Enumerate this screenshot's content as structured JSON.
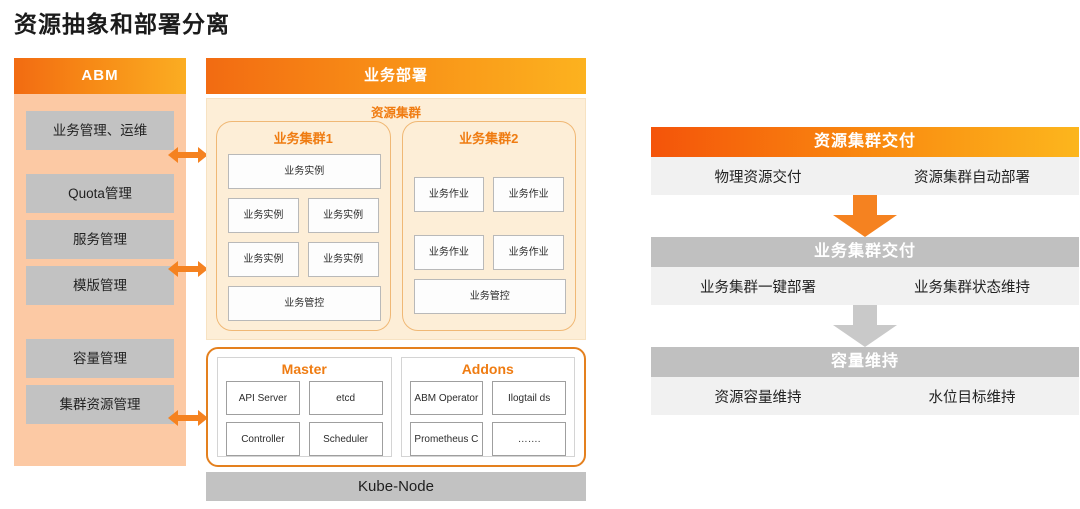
{
  "title": "资源抽象和部署分离",
  "colors": {
    "orange": "#f07c12",
    "orange_dark": "#f4540a",
    "orange_light": "#fcb21f",
    "grey_box": "#c2c2c2",
    "peach": "#fcc9a4",
    "cream": "#fdeed7"
  },
  "abm": {
    "header": "ABM",
    "items": [
      {
        "label": "业务管理、运维"
      },
      {
        "label": "Quota管理"
      },
      {
        "label": "服务管理"
      },
      {
        "label": "模版管理"
      },
      {
        "label": "容量管理"
      },
      {
        "label": "集群资源管理"
      }
    ]
  },
  "deploy": {
    "header": "业务部署",
    "resource_cluster_title": "资源集群",
    "clusters": [
      {
        "title": "业务集群1",
        "top_cell": "业务实例",
        "grid": [
          [
            "业务实例",
            "业务实例"
          ],
          [
            "业务实例",
            "业务实例"
          ]
        ],
        "bottom_cell": "业务管控"
      },
      {
        "title": "业务集群2",
        "top_cell": "",
        "grid": [
          [
            "业务作业",
            "业务作业"
          ],
          [
            "业务作业",
            "业务作业"
          ]
        ],
        "bottom_cell": "业务管控"
      }
    ],
    "master": {
      "title": "Master",
      "cells": [
        [
          "API Server",
          "etcd"
        ],
        [
          "Controller",
          "Scheduler"
        ]
      ]
    },
    "addons": {
      "title": "Addons",
      "cells": [
        [
          "ABM Operator",
          "Ilogtail ds"
        ],
        [
          "Prometheus C",
          "……."
        ]
      ]
    },
    "kube_node": "Kube-Node"
  },
  "flow": {
    "sections": [
      {
        "header": "资源集群交付",
        "style": "orange",
        "left": "物理资源交付",
        "right": "资源集群自动部署",
        "arrow_color": "#f58220"
      },
      {
        "header": "业务集群交付",
        "style": "grey",
        "left": "业务集群一键部署",
        "right": "业务集群状态维持",
        "arrow_color": "#c9c9c9"
      },
      {
        "header": "容量维持",
        "style": "grey",
        "left": "资源容量维持",
        "right": "水位目标维持",
        "arrow_color": ""
      }
    ]
  }
}
